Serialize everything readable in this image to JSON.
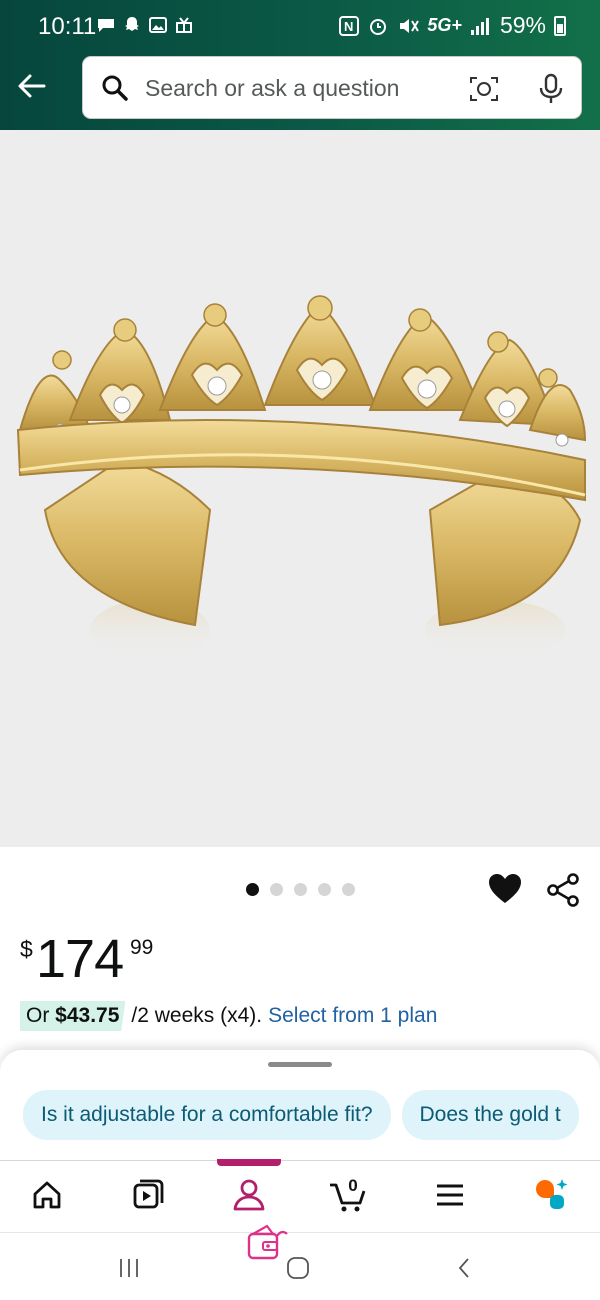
{
  "status_bar": {
    "time": "10:11",
    "network": "5G+",
    "battery": "59%"
  },
  "header": {
    "search": {
      "placeholder": "Search or ask a question"
    }
  },
  "product": {
    "image_index": 1,
    "image_count": 5,
    "price": {
      "currency": "$",
      "whole": "174",
      "fraction": "99"
    },
    "installment": {
      "prefix": "Or",
      "amount": "$43.75",
      "term": "/2 weeks (x4).",
      "link": "Select from 1 plan"
    }
  },
  "suggestions": {
    "questions": [
      "Is it adjustable for a comfortable fit?",
      "Does the gold t"
    ]
  },
  "bottom_nav": {
    "tabs": [
      "home",
      "video",
      "account",
      "cart",
      "menu",
      "rufus"
    ],
    "active_tab": "account",
    "cart_count": "0"
  },
  "colors": {
    "header_gradient_start": "#06463d",
    "header_gradient_end": "#127049",
    "accent_active": "#b21f6b",
    "link": "#2162a1",
    "chip_bg": "#dff3fa"
  }
}
